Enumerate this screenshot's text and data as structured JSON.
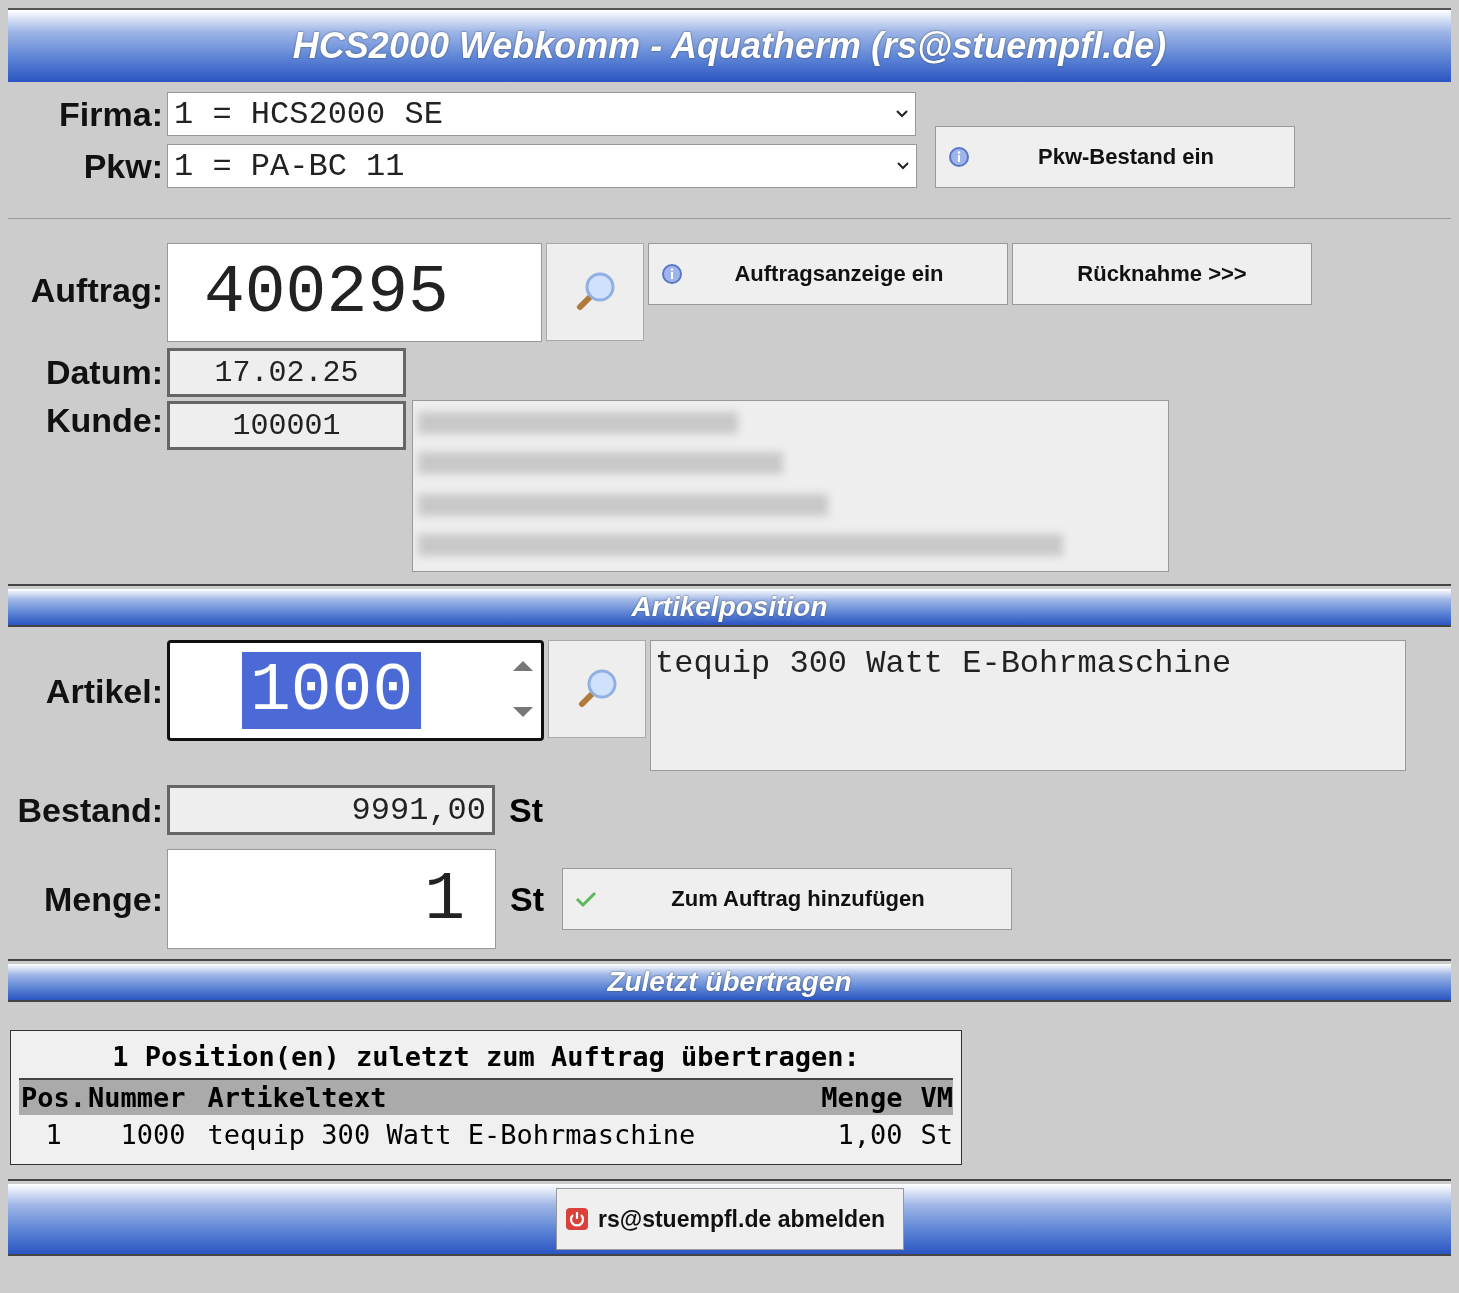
{
  "window": {
    "title": "HCS2000 Webkomm - Aquatherm (rs@stuempfl.de)"
  },
  "selectors": [
    {
      "label": "Firma:",
      "value": "1 = HCS2000 SE"
    },
    {
      "label": "Pkw:",
      "value": "1 = PA-BC 11"
    }
  ],
  "pkw_button": "Pkw-Bestand ein",
  "order": {
    "label": "Auftrag:",
    "value": "400295",
    "info_button": "Auftragsanzeige ein",
    "return_button": "Rücknahme >>>"
  },
  "date": {
    "label": "Datum:",
    "value": "17.02.25"
  },
  "customer": {
    "label": "Kunde:",
    "value": "100001",
    "address": {
      "kind": "blurred"
    }
  },
  "article_section": {
    "title": "Artikelposition"
  },
  "article": {
    "label": "Artikel:",
    "value": "1000",
    "selected": true,
    "description": "tequip 300 Watt E-Bohrmaschine"
  },
  "stock": {
    "label": "Bestand:",
    "value": "9991,00",
    "unit": "St"
  },
  "quantity": {
    "label": "Menge:",
    "value": "1",
    "unit": "St",
    "add_button": "Zum Auftrag hinzufügen"
  },
  "recent_section": {
    "title": "Zuletzt übertragen"
  },
  "recent": {
    "summary": "1 Position(en) zuletzt zum Auftrag übertragen:",
    "columns": [
      "Pos.",
      "Nummer",
      "Artikeltext",
      "Menge",
      "VM"
    ],
    "rows": [
      [
        "1",
        "1000",
        "tequip 300 Watt E-Bohrmaschine",
        "1,00",
        "St"
      ]
    ]
  },
  "logout_button": "rs@stuempfl.de abmelden"
}
